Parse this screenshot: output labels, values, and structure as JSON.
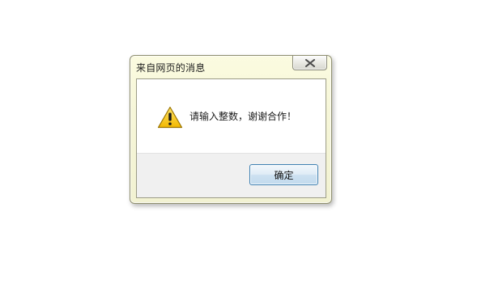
{
  "dialog": {
    "title": "来自网页的消息",
    "message": "请输入整数，谢谢合作！",
    "ok_label": "确定",
    "icon": "warning-icon",
    "close_icon": "close-icon"
  },
  "colors": {
    "frame": "#f6f6d8",
    "button_border": "#3c7fb1",
    "button_area": "#f0f0f0",
    "warning_yellow": "#f6c21a"
  }
}
